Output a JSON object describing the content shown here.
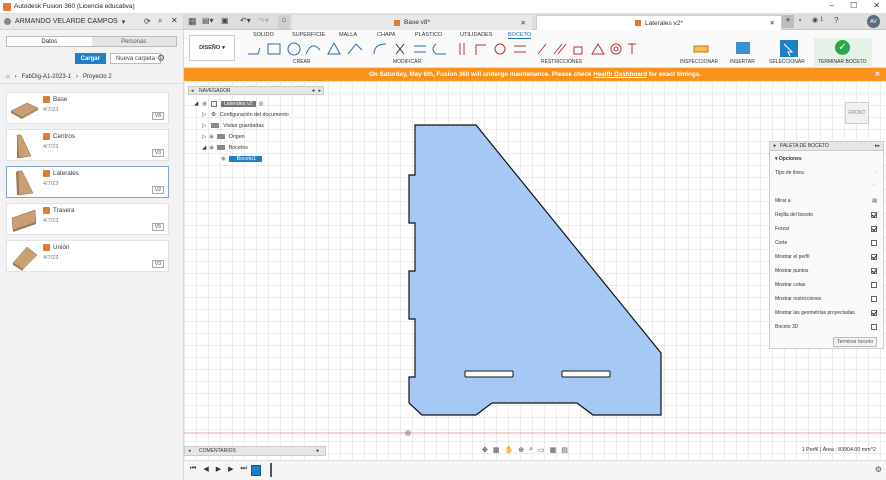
{
  "window": {
    "title": "Autodesk Fusion 360 (Licencia educativa)",
    "controls": [
      "–",
      "☐",
      "✕"
    ]
  },
  "left_panel": {
    "user": "ARMANDO VELARDE CAMPOS",
    "tabs": [
      "Datos",
      "Personas"
    ],
    "active_tab": "Datos",
    "upload_label": "Cargar",
    "new_folder_label": "Nueva carpeta",
    "breadcrumb": [
      "FabDig-A1-2023-1",
      "Proyecto 2"
    ],
    "items": [
      {
        "name": "Base",
        "date": "4/7/23",
        "version": "V8"
      },
      {
        "name": "Centros",
        "date": "4/7/23",
        "version": "V3"
      },
      {
        "name": "Laterales",
        "date": "4/7/23",
        "version": "V2"
      },
      {
        "name": "Trasera",
        "date": "4/7/23",
        "version": "V5"
      },
      {
        "name": "Unión",
        "date": "4/7/23",
        "version": "V3"
      }
    ]
  },
  "doc_tabs": [
    {
      "label": "Base v8*",
      "active": false
    },
    {
      "label": "Laterales v2*",
      "active": true
    }
  ],
  "profile_initials": "AV",
  "notification_count": "1",
  "ribbon": {
    "workspace": "DISEÑO",
    "tabs": [
      "SOLIDO",
      "SUPERFICIE",
      "MALLA",
      "CHAPA",
      "PLÁSTICO",
      "UTILIDADES",
      "BOCETO"
    ],
    "active_tab": "BOCETO",
    "groups": [
      "CREAR",
      "MODIFICAR",
      "RESTRICCIONES",
      "INSPECCIONAR",
      "INSERTAR",
      "SELECCIONAR",
      "TERMINAR BOCETO"
    ]
  },
  "banner": {
    "text": "On Saturday, May 6th, Fusion 360 will undergo maintenance. Please check",
    "link": "Health Dashboard",
    "suffix": "for exact timings."
  },
  "navigator": {
    "title": "NAVEGADOR",
    "root": "Laterales v2",
    "rows": [
      "Configuración del documento",
      "Vistas guardadas",
      "Origen",
      "Bocetos"
    ],
    "sketch": "Boceto1"
  },
  "viewcube_label": "FRONT",
  "palette": {
    "title": "PALETA DE BOCETO",
    "section": "Opciones",
    "rows": [
      {
        "label": "Tipo de línea",
        "kind": "icon"
      },
      {
        "label": "",
        "kind": "icon2"
      },
      {
        "label": "Mirar a",
        "kind": "icon3"
      },
      {
        "label": "Rejilla del boceto",
        "checked": true
      },
      {
        "label": "Forzar",
        "checked": true
      },
      {
        "label": "Corte",
        "checked": false
      },
      {
        "label": "Mostrar el perfil",
        "checked": true
      },
      {
        "label": "Mostrar puntos",
        "checked": true
      },
      {
        "label": "Mostrar cotas",
        "checked": false
      },
      {
        "label": "Mostrar restricciones",
        "checked": false
      },
      {
        "label": "Mostrar las geometrías proyectadas",
        "checked": true
      },
      {
        "label": "Boceto 3D",
        "checked": false
      }
    ],
    "finish_label": "Terminar boceto"
  },
  "comments_label": "COMENTARIOS",
  "status_text": "1 Perfil | Área : 83904.00 mm^2",
  "colors": {
    "accent": "#1e80c8",
    "banner": "#f7931e",
    "profile_fill": "#a6c8f5",
    "finish_green": "#2aa845"
  }
}
